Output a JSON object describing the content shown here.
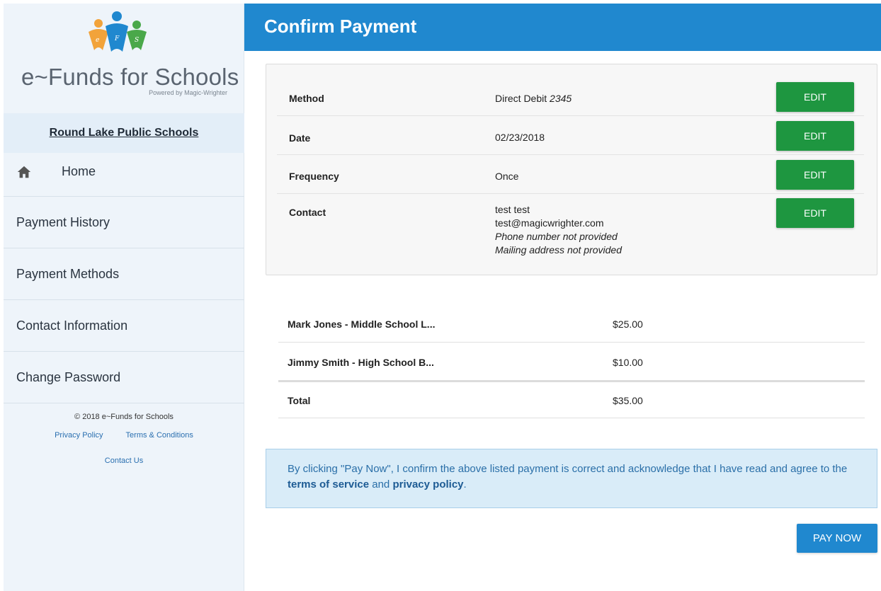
{
  "sidebar": {
    "logo_text": "e~Funds for Schools",
    "logo_subtext": "Powered by Magic-Wrighter",
    "school_name": "Round Lake Public Schools",
    "home_label": "Home",
    "items": [
      {
        "label": "Payment History"
      },
      {
        "label": "Payment Methods"
      },
      {
        "label": "Contact Information"
      },
      {
        "label": "Change Password"
      }
    ],
    "footer": {
      "copyright": "© 2018 e~Funds for Schools",
      "privacy": "Privacy Policy",
      "terms": "Terms & Conditions",
      "contact": "Contact Us"
    }
  },
  "header": {
    "title": "Confirm Payment"
  },
  "details": {
    "method_label": "Method",
    "method_value": "Direct Debit ",
    "method_last4": "2345",
    "date_label": "Date",
    "date_value": "02/23/2018",
    "frequency_label": "Frequency",
    "frequency_value": "Once",
    "contact_label": "Contact",
    "contact_name": "test test",
    "contact_email": "test@magicwrighter.com",
    "contact_phone": "Phone number not provided",
    "contact_address": "Mailing address not provided",
    "edit_label": "EDIT"
  },
  "items": [
    {
      "name": "Mark Jones - Middle School L...",
      "amount": "$25.00"
    },
    {
      "name": "Jimmy Smith - High School B...",
      "amount": "$10.00"
    }
  ],
  "total": {
    "label": "Total",
    "amount": "$35.00"
  },
  "notice": {
    "text_before": "By clicking \"Pay Now\", I confirm the above listed payment is correct and acknowledge that I have read and agree to the ",
    "terms": "terms of service",
    "and": " and ",
    "privacy": "privacy policy",
    "end": "."
  },
  "pay_now_label": "PAY NOW",
  "colors": {
    "header": "#2088cf",
    "edit_button": "#1e9640",
    "sidebar_bg": "#eef4fa"
  }
}
